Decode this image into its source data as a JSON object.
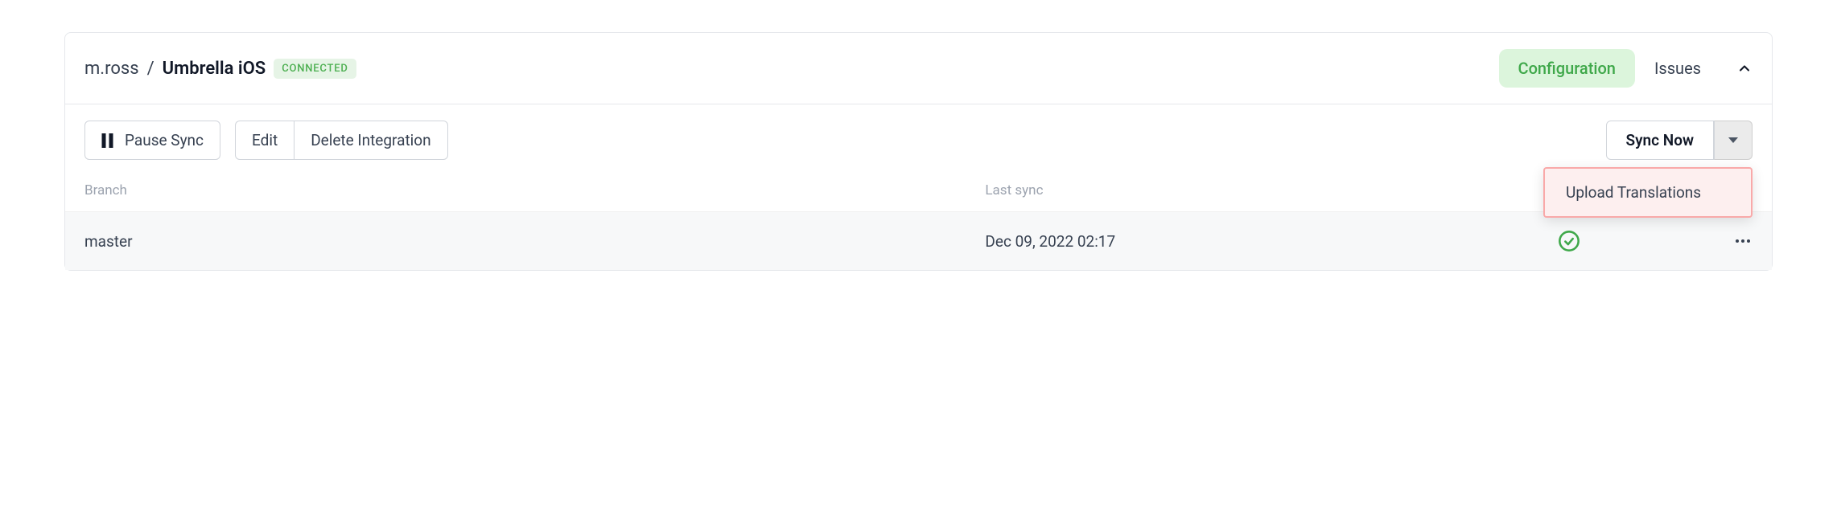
{
  "header": {
    "owner": "m.ross",
    "separator": "/",
    "project": "Umbrella iOS",
    "status": "CONNECTED"
  },
  "tabs": {
    "configuration": "Configuration",
    "issues": "Issues"
  },
  "toolbar": {
    "pause_sync": "Pause Sync",
    "edit": "Edit",
    "delete_integration": "Delete Integration",
    "sync_now": "Sync Now"
  },
  "dropdown": {
    "upload_translations": "Upload Translations"
  },
  "table": {
    "headers": {
      "branch": "Branch",
      "last_sync": "Last sync"
    },
    "rows": [
      {
        "branch": "master",
        "last_sync": "Dec 09, 2022 02:17",
        "status": "success"
      }
    ]
  },
  "icons": {
    "pause": "pause-icon",
    "chevron_up": "chevron-up-icon",
    "caret_down": "caret-down-icon",
    "check_circle": "check-circle-icon",
    "more": "more-horizontal-icon"
  },
  "colors": {
    "success_green": "#3fa84a",
    "badge_bg": "#e6f4e6",
    "tab_active_bg": "#dcf5dc",
    "highlight_border": "#f9a9a9",
    "highlight_bg": "#fdefef"
  }
}
